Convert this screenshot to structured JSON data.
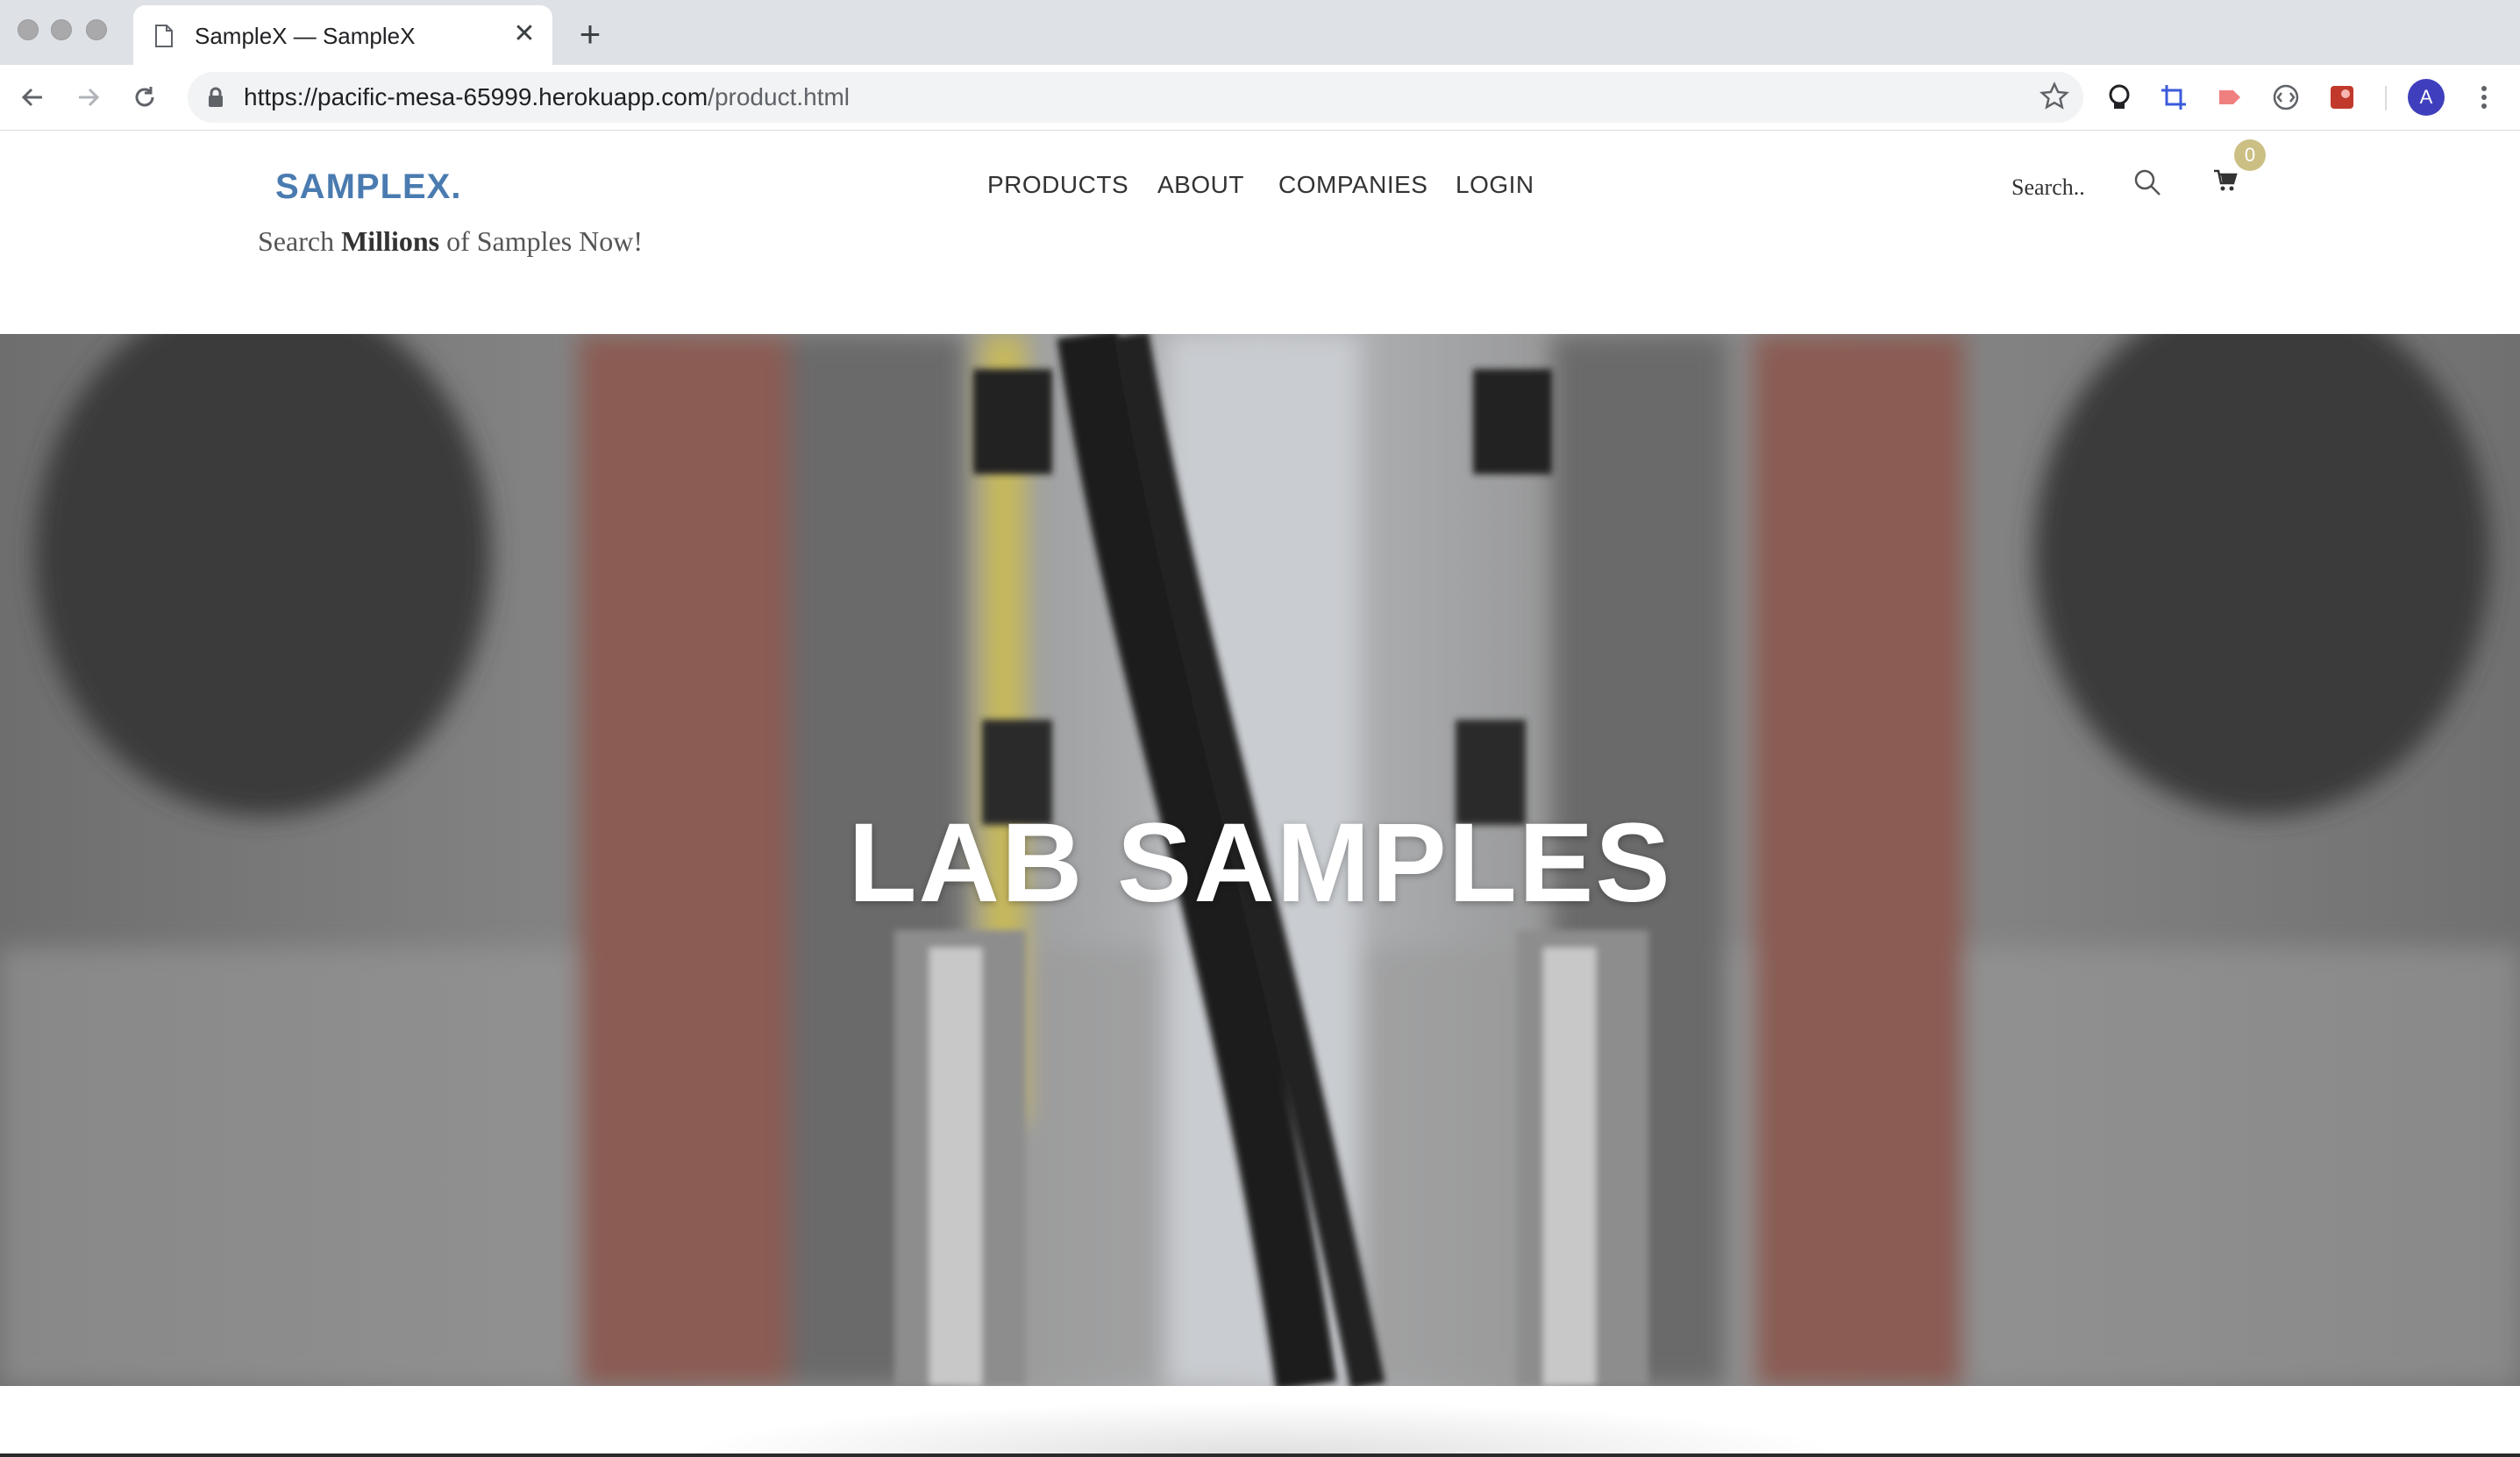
{
  "browser": {
    "tab_title": "SampleX — SampleX",
    "url_host": "https://pacific-mesa-65999.herokuapp.com",
    "url_path": "/product.html",
    "avatar_letter": "A"
  },
  "site": {
    "logo": "SAMPLEX.",
    "tagline_pre": "Search ",
    "tagline_bold": "Millions",
    "tagline_post": " of Samples Now!",
    "nav": [
      "PRODUCTS",
      "ABOUT",
      "COMPANIES",
      "LOGIN"
    ],
    "search_placeholder": "Search..",
    "cart_count": "0"
  },
  "hero": {
    "title": "LAB SAMPLES"
  },
  "colors": {
    "logo": "#4a7bb0",
    "badge": "#cbbf83"
  }
}
